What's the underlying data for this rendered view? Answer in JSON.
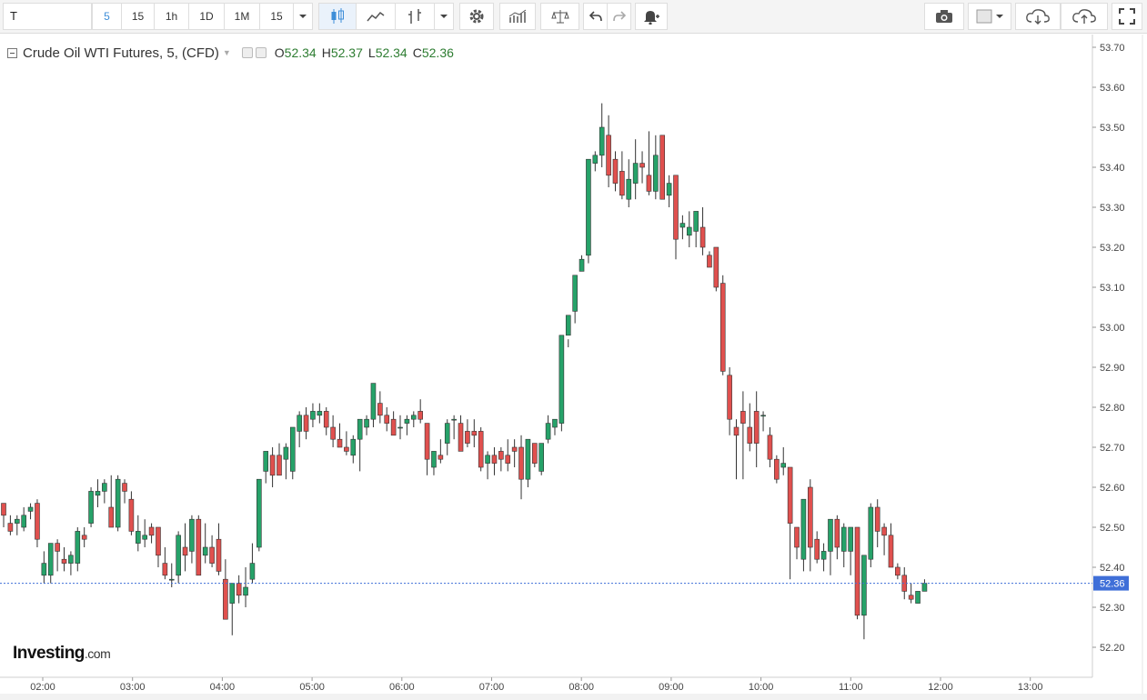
{
  "toolbar": {
    "symbol": "T",
    "intervals": [
      "5",
      "15",
      "1h",
      "1D",
      "1M"
    ],
    "active_interval": "5",
    "interval_dropdown": "15",
    "icons": [
      "candles-icon",
      "line-chart-icon",
      "bars-icon",
      "dropdown-icon",
      "gear-icon",
      "indicators-icon",
      "compare-icon",
      "undo-icon",
      "redo-icon",
      "alert-icon",
      "camera-icon",
      "color-square-icon",
      "cloud-download-icon",
      "cloud-upload-icon",
      "fullscreen-icon"
    ]
  },
  "legend": {
    "title": "Crude Oil WTI Futures, 5, (CFD)",
    "open_label": "O",
    "open": "52.34",
    "high_label": "H",
    "high": "52.37",
    "low_label": "L",
    "low": "52.34",
    "close_label": "C",
    "close": "52.36"
  },
  "brand": {
    "name": "Investing",
    "suffix": ".com"
  },
  "colors": {
    "up": "#26a269",
    "down": "#e0504e",
    "last_price": "#3f6fd8",
    "axis_text": "#444444"
  },
  "chart_data": {
    "type": "candlestick",
    "title": "Crude Oil WTI Futures, 5, (CFD)",
    "interval_minutes": 5,
    "x_ticks": [
      "02:00",
      "03:00",
      "04:00",
      "05:00",
      "06:00",
      "07:00",
      "08:00",
      "09:00",
      "10:00",
      "11:00",
      "12:00",
      "13:00"
    ],
    "y_ticks": [
      "53.70",
      "53.60",
      "53.50",
      "53.40",
      "53.30",
      "53.20",
      "53.10",
      "53.00",
      "52.90",
      "52.80",
      "52.70",
      "52.60",
      "52.50",
      "52.40",
      "52.30",
      "52.20"
    ],
    "ylim": [
      52.14,
      53.73
    ],
    "last_price": 52.36,
    "last_price_label": "52.36",
    "grid": false,
    "candles": [
      [
        52.56,
        52.56,
        52.5,
        52.53
      ],
      [
        52.51,
        52.53,
        52.48,
        52.49
      ],
      [
        52.51,
        52.53,
        52.48,
        52.52
      ],
      [
        52.5,
        52.55,
        52.49,
        52.53
      ],
      [
        52.54,
        52.56,
        52.52,
        52.55
      ],
      [
        52.56,
        52.57,
        52.45,
        52.47
      ],
      [
        52.38,
        52.44,
        52.36,
        52.41
      ],
      [
        52.38,
        52.46,
        52.36,
        52.46
      ],
      [
        52.46,
        52.47,
        52.39,
        52.44
      ],
      [
        52.42,
        52.45,
        52.39,
        52.41
      ],
      [
        52.41,
        52.44,
        52.38,
        52.43
      ],
      [
        52.41,
        52.5,
        52.39,
        52.49
      ],
      [
        52.48,
        52.5,
        52.45,
        52.47
      ],
      [
        52.51,
        52.6,
        52.5,
        52.59
      ],
      [
        52.58,
        52.62,
        52.55,
        52.59
      ],
      [
        52.59,
        52.62,
        52.56,
        52.61
      ],
      [
        52.55,
        52.63,
        52.53,
        52.5
      ],
      [
        52.5,
        52.63,
        52.49,
        52.62
      ],
      [
        52.61,
        52.62,
        52.56,
        52.59
      ],
      [
        52.57,
        52.59,
        52.48,
        52.49
      ],
      [
        52.46,
        52.53,
        52.44,
        52.49
      ],
      [
        52.47,
        52.52,
        52.45,
        52.48
      ],
      [
        52.5,
        52.51,
        52.46,
        52.48
      ],
      [
        52.5,
        52.5,
        52.4,
        52.43
      ],
      [
        52.41,
        52.45,
        52.37,
        52.38
      ],
      [
        52.37,
        52.41,
        52.35,
        52.37
      ],
      [
        52.38,
        52.49,
        52.36,
        52.48
      ],
      [
        52.45,
        52.51,
        52.39,
        52.43
      ],
      [
        52.44,
        52.53,
        52.41,
        52.52
      ],
      [
        52.52,
        52.53,
        52.45,
        52.38
      ],
      [
        52.43,
        52.51,
        52.41,
        52.45
      ],
      [
        52.45,
        52.48,
        52.4,
        52.41
      ],
      [
        52.47,
        52.51,
        52.38,
        52.39
      ],
      [
        52.37,
        52.42,
        52.32,
        52.27
      ],
      [
        52.31,
        52.35,
        52.23,
        52.36
      ],
      [
        52.36,
        52.38,
        52.31,
        52.33
      ],
      [
        52.33,
        52.4,
        52.3,
        52.35
      ],
      [
        52.37,
        52.46,
        52.36,
        52.41
      ],
      [
        52.45,
        52.62,
        52.44,
        52.62
      ],
      [
        52.64,
        52.68,
        52.61,
        52.69
      ],
      [
        52.68,
        52.7,
        52.6,
        52.63
      ],
      [
        52.68,
        52.71,
        52.63,
        52.63
      ],
      [
        52.67,
        52.71,
        52.62,
        52.7
      ],
      [
        52.64,
        52.7,
        52.62,
        52.75
      ],
      [
        52.74,
        52.79,
        52.7,
        52.78
      ],
      [
        52.78,
        52.8,
        52.72,
        52.74
      ],
      [
        52.77,
        52.81,
        52.75,
        52.79
      ],
      [
        52.78,
        52.81,
        52.76,
        52.79
      ],
      [
        52.79,
        52.8,
        52.73,
        52.75
      ],
      [
        52.75,
        52.78,
        52.7,
        52.72
      ],
      [
        52.72,
        52.76,
        52.7,
        52.7
      ],
      [
        52.7,
        52.74,
        52.68,
        52.69
      ],
      [
        52.68,
        52.73,
        52.66,
        52.72
      ],
      [
        52.72,
        52.76,
        52.64,
        52.77
      ],
      [
        52.75,
        52.78,
        52.73,
        52.77
      ],
      [
        52.77,
        52.86,
        52.75,
        52.86
      ],
      [
        52.81,
        52.84,
        52.76,
        52.78
      ],
      [
        52.78,
        52.8,
        52.74,
        52.76
      ],
      [
        52.77,
        52.79,
        52.74,
        52.73
      ],
      [
        52.75,
        52.78,
        52.72,
        52.75
      ],
      [
        52.76,
        52.78,
        52.73,
        52.77
      ],
      [
        52.77,
        52.79,
        52.75,
        52.78
      ],
      [
        52.79,
        52.82,
        52.76,
        52.77
      ],
      [
        52.76,
        52.76,
        52.63,
        52.67
      ],
      [
        52.65,
        52.69,
        52.63,
        52.69
      ],
      [
        52.68,
        52.72,
        52.66,
        52.67
      ],
      [
        52.71,
        52.77,
        52.68,
        52.76
      ],
      [
        52.77,
        52.78,
        52.72,
        52.77
      ],
      [
        52.76,
        52.78,
        52.7,
        52.69
      ],
      [
        52.74,
        52.77,
        52.7,
        52.71
      ],
      [
        52.74,
        52.77,
        52.7,
        52.73
      ],
      [
        52.74,
        52.75,
        52.64,
        52.65
      ],
      [
        52.66,
        52.69,
        52.62,
        52.68
      ],
      [
        52.68,
        52.7,
        52.63,
        52.66
      ],
      [
        52.69,
        52.7,
        52.64,
        52.67
      ],
      [
        52.68,
        52.72,
        52.64,
        52.66
      ],
      [
        52.7,
        52.72,
        52.65,
        52.69
      ],
      [
        52.7,
        52.73,
        52.57,
        52.62
      ],
      [
        52.62,
        52.7,
        52.6,
        52.72
      ],
      [
        52.71,
        52.71,
        52.65,
        52.66
      ],
      [
        52.64,
        52.7,
        52.63,
        52.71
      ],
      [
        52.72,
        52.78,
        52.71,
        52.76
      ],
      [
        52.75,
        52.77,
        52.73,
        52.77
      ],
      [
        52.76,
        52.8,
        52.74,
        52.98
      ],
      [
        52.98,
        52.97,
        52.95,
        53.03
      ],
      [
        53.04,
        53.08,
        53.01,
        53.13
      ],
      [
        53.14,
        53.18,
        53.14,
        53.17
      ],
      [
        53.18,
        53.2,
        53.16,
        53.42
      ],
      [
        53.41,
        53.44,
        53.39,
        53.43
      ],
      [
        53.43,
        53.56,
        53.4,
        53.5
      ],
      [
        53.48,
        53.53,
        53.35,
        53.38
      ],
      [
        53.42,
        53.44,
        53.34,
        53.36
      ],
      [
        53.39,
        53.44,
        53.32,
        53.33
      ],
      [
        53.32,
        53.42,
        53.3,
        53.37
      ],
      [
        53.36,
        53.47,
        53.32,
        53.41
      ],
      [
        53.41,
        53.44,
        53.36,
        53.4
      ],
      [
        53.38,
        53.49,
        53.33,
        53.34
      ],
      [
        53.34,
        53.48,
        53.32,
        53.43
      ],
      [
        53.48,
        53.48,
        53.39,
        53.32
      ],
      [
        53.33,
        53.38,
        53.3,
        53.36
      ],
      [
        53.38,
        53.38,
        53.17,
        53.22
      ],
      [
        53.25,
        53.28,
        53.22,
        53.26
      ],
      [
        53.23,
        53.29,
        53.2,
        53.25
      ],
      [
        53.24,
        53.28,
        53.2,
        53.29
      ],
      [
        53.25,
        53.3,
        53.18,
        53.2
      ],
      [
        53.18,
        53.19,
        53.15,
        53.15
      ],
      [
        53.2,
        53.2,
        53.09,
        53.1
      ],
      [
        53.11,
        53.13,
        52.88,
        52.89
      ],
      [
        52.88,
        52.9,
        52.73,
        52.77
      ],
      [
        52.75,
        52.77,
        52.62,
        52.73
      ],
      [
        52.79,
        52.84,
        52.62,
        52.76
      ],
      [
        52.75,
        52.81,
        52.69,
        52.71
      ],
      [
        52.79,
        52.84,
        52.65,
        52.71
      ],
      [
        52.78,
        52.79,
        52.74,
        52.78
      ],
      [
        52.73,
        52.75,
        52.65,
        52.67
      ],
      [
        52.67,
        52.68,
        52.61,
        52.62
      ],
      [
        52.65,
        52.7,
        52.63,
        52.66
      ],
      [
        52.65,
        52.65,
        52.37,
        52.51
      ],
      [
        52.5,
        52.49,
        52.42,
        52.45
      ],
      [
        52.42,
        52.54,
        52.39,
        52.57
      ],
      [
        52.6,
        52.62,
        52.39,
        52.45
      ],
      [
        52.47,
        52.49,
        52.41,
        52.42
      ],
      [
        52.42,
        52.46,
        52.39,
        52.44
      ],
      [
        52.44,
        52.51,
        52.38,
        52.52
      ],
      [
        52.52,
        52.53,
        52.42,
        52.45
      ],
      [
        52.44,
        52.51,
        52.4,
        52.5
      ],
      [
        52.44,
        52.48,
        52.38,
        52.5
      ],
      [
        52.5,
        52.46,
        52.27,
        52.28
      ],
      [
        52.28,
        52.43,
        52.22,
        52.43
      ],
      [
        52.42,
        52.56,
        52.4,
        52.55
      ],
      [
        52.55,
        52.57,
        52.45,
        52.49
      ],
      [
        52.5,
        52.51,
        52.43,
        52.48
      ],
      [
        52.48,
        52.51,
        52.4,
        52.4
      ],
      [
        52.4,
        52.41,
        52.37,
        52.38
      ],
      [
        52.38,
        52.4,
        52.32,
        52.34
      ],
      [
        52.33,
        52.36,
        52.31,
        52.32
      ],
      [
        52.31,
        52.34,
        52.31,
        52.34
      ],
      [
        52.34,
        52.37,
        52.34,
        52.36
      ]
    ]
  }
}
